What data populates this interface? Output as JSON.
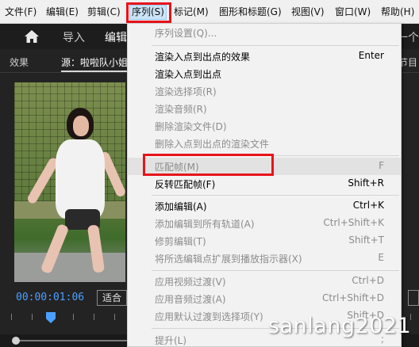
{
  "menubar": {
    "items": [
      {
        "label": "文件(F)"
      },
      {
        "label": "编辑(E)"
      },
      {
        "label": "剪辑(C)"
      },
      {
        "label": "序列(S)"
      },
      {
        "label": "标记(M)"
      },
      {
        "label": "图形和标题(G)"
      },
      {
        "label": "视图(V)"
      },
      {
        "label": "窗口(W)"
      },
      {
        "label": "帮助(H)"
      }
    ]
  },
  "workspace": {
    "tabs": [
      {
        "label": "导入"
      },
      {
        "label": "编辑"
      }
    ],
    "right_label": "一个"
  },
  "panel": {
    "effects_tab": "效果",
    "source_tab": "源：啦啦队小姐",
    "right_tab": "节目"
  },
  "monitor": {
    "timecode": "00:00:01:06",
    "fit": "适合"
  },
  "sequence_menu": {
    "items": [
      {
        "label": "序列设置(Q)...",
        "shortcut": "",
        "enabled": false
      },
      {
        "label": "渲染入点到出点的效果",
        "shortcut": "Enter",
        "enabled": true
      },
      {
        "label": "渲染入点到出点",
        "shortcut": "",
        "enabled": true
      },
      {
        "label": "渲染选择项(R)",
        "shortcut": "",
        "enabled": false
      },
      {
        "label": "渲染音频(R)",
        "shortcut": "",
        "enabled": false
      },
      {
        "label": "删除渲染文件(D)",
        "shortcut": "",
        "enabled": false
      },
      {
        "label": "删除入点到出点的渲染文件",
        "shortcut": "",
        "enabled": false
      },
      {
        "label": "匹配帧(M)",
        "shortcut": "F",
        "enabled": false
      },
      {
        "label": "反转匹配帧(F)",
        "shortcut": "Shift+R",
        "enabled": true
      },
      {
        "label": "添加编辑(A)",
        "shortcut": "Ctrl+K",
        "enabled": true
      },
      {
        "label": "添加编辑到所有轨道(A)",
        "shortcut": "Ctrl+Shift+K",
        "enabled": false
      },
      {
        "label": "修剪编辑(T)",
        "shortcut": "Shift+T",
        "enabled": false
      },
      {
        "label": "将所选编辑点扩展到播放指示器(X)",
        "shortcut": "E",
        "enabled": false
      },
      {
        "label": "应用视频过渡(V)",
        "shortcut": "Ctrl+D",
        "enabled": false
      },
      {
        "label": "应用音频过渡(A)",
        "shortcut": "Ctrl+Shift+D",
        "enabled": false
      },
      {
        "label": "应用默认过渡到选择项(Y)",
        "shortcut": "Shift+D",
        "enabled": false
      },
      {
        "label": "提升(L)",
        "shortcut": ";",
        "enabled": false
      }
    ]
  },
  "watermark": "sanlang2021",
  "colors": {
    "highlight_red": "#e8131b",
    "timecode_blue": "#4aa0ff"
  }
}
